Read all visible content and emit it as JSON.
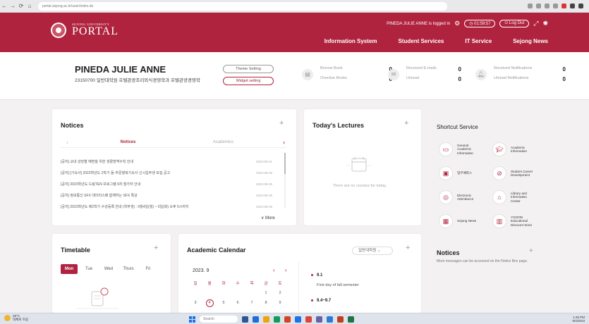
{
  "browser": {
    "url": "portal.sejong.ac.kr/user/index.do",
    "nav": [
      "←",
      "→",
      "⟳",
      "⌂"
    ]
  },
  "header": {
    "logo_small": "SEJONG UNIVERSITY",
    "logo_big": "PORTAL",
    "logged_in_text": "PINEDA JULIE ANNE is logged in",
    "timer": "01:59:57",
    "logout": "Log Out",
    "menu": [
      "Information System",
      "Student Services",
      "IT Service",
      "Sejong News"
    ],
    "colors": {
      "brand": "#b0233e"
    }
  },
  "profile": {
    "name": "PINEDA JULIE ANNE",
    "id_line": "23150700   일반대학원 호텔관광조리외식경영학과 호텔관광경영학",
    "theme_button": "Theme Setting",
    "widget_button": "Widget setting",
    "stats": [
      {
        "icon": "book-icon",
        "rows": [
          {
            "label": "Borrow Book",
            "value": "0"
          },
          {
            "label": "Overdue Books",
            "value": "0"
          }
        ]
      },
      {
        "icon": "mail-icon",
        "rows": [
          {
            "label": "Received E-mails",
            "value": "0"
          },
          {
            "label": "Unread",
            "value": "0"
          }
        ]
      },
      {
        "icon": "bell-icon",
        "rows": [
          {
            "label": "Received Notifications",
            "value": "0"
          },
          {
            "label": "Unread Notifications",
            "value": "0"
          }
        ]
      }
    ]
  },
  "notices": {
    "title": "Notices",
    "plus": "+",
    "tabs": [
      "Notices",
      "Academics"
    ],
    "items": [
      {
        "text": "[공지] 교내 강당별 예방을 위한 생활방역수칙 안내",
        "date": "2023-08-31"
      },
      {
        "text": "[공지] [기숙사] 2023학년도 2학기 동·추문행복기숙사 신시입주생 모집 공고",
        "date": "2023-08-29"
      },
      {
        "text": "[공지] 2023학년도 드림TEN 프로그램 9차 참가자 안내",
        "date": "2023-08-29"
      },
      {
        "text": "[공지] 정보통신 SFX 데이터스페 함께하는 SFX 특강",
        "date": "2023-08-28"
      },
      {
        "text": "[공지] 2023학년도 제2학기 수강등록 안내 (학부생) : 9월4일(월) ~ 5일(화) 오후 5시까지",
        "date": "2023-08-28"
      }
    ],
    "more": "∨ More"
  },
  "lectures": {
    "title": "Today's Lectures",
    "plus": "+",
    "empty": "There are no courses for today."
  },
  "shortcut": {
    "title": "Shortcut Service",
    "items": [
      {
        "icon": "monitor-icon",
        "label": "General\nAcademic\nInformation"
      },
      {
        "icon": "graduation-cap-icon",
        "label": "Academic\nInformation"
      },
      {
        "icon": "id-card-icon",
        "label": "업무예약스"
      },
      {
        "icon": "compass-icon",
        "label": "Student Career\nDevelopment"
      },
      {
        "icon": "attendance-icon",
        "label": "Electronic\nAttendance"
      },
      {
        "icon": "library-icon",
        "label": "Library and\nInformation\nCenter"
      },
      {
        "icon": "news-icon",
        "label": "Sejong News"
      },
      {
        "icon": "store-icon",
        "label": "YGOON\nEducational\nDiscount Store"
      }
    ]
  },
  "side_notices": {
    "title": "Notices",
    "plus": "+",
    "text": "More messages can be accessed on the Notice Box page."
  },
  "timetable": {
    "title": "Timetable",
    "plus": "+",
    "days": [
      "Mon",
      "Tue",
      "Wed",
      "Thurs",
      "Fri"
    ]
  },
  "calendar": {
    "title": "Academic Calendar",
    "plus": "+",
    "select": "일반대학원",
    "month": "2023. 9",
    "arrows": "‹ ›",
    "weekdays": [
      "일",
      "월",
      "화",
      "수",
      "목",
      "금",
      "토"
    ],
    "weeks": [
      [
        "",
        "",
        "",
        "",
        "",
        "1",
        "2"
      ],
      [
        "3",
        "4",
        "5",
        "6",
        "7",
        "8",
        "9"
      ]
    ],
    "today": "4",
    "events": [
      {
        "date": "9.1",
        "desc": "First day of fall semester"
      },
      {
        "date": "9.4~9.7",
        "desc": ""
      }
    ]
  },
  "taskbar": {
    "weather_temp": "29°C",
    "weather_desc": "대체로 흐림",
    "search": "Search",
    "clock_time": "1:45 PM",
    "clock_date": "9/4/2023"
  }
}
